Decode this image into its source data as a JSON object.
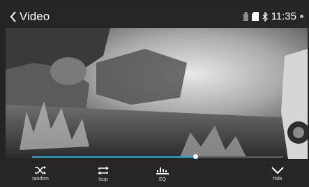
{
  "header": {
    "title": "Video",
    "time": "11:35"
  },
  "player": {
    "progress_fraction": 0.65
  },
  "controls": {
    "random_label": "random",
    "loop_label": "loop",
    "eq_label": "EQ",
    "hide_label": "hide"
  },
  "colors": {
    "accent": "#1fa8e8",
    "bar_bg": "#262626"
  },
  "icons": [
    "back-chevron-icon",
    "usb-icon",
    "sd-card-icon",
    "bluetooth-icon",
    "shuffle-icon",
    "loop-icon",
    "equalizer-icon",
    "hide-chevron-icon"
  ]
}
